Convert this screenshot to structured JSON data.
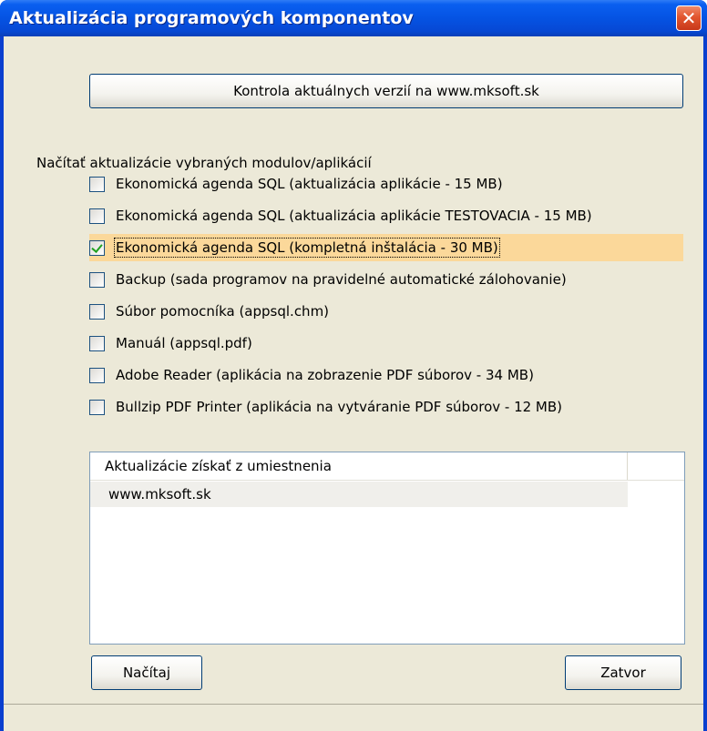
{
  "window": {
    "title": "Aktualizácia programových komponentov",
    "close_symbol": "✕"
  },
  "buttons": {
    "check_versions": "Kontrola aktuálnych verzií na www.mksoft.sk",
    "load": "Načítaj",
    "close": "Zatvor"
  },
  "modules": {
    "label": "Načítať aktualizácie vybraných modulov/aplikácií",
    "items": [
      {
        "label": "Ekonomická agenda SQL (aktualizácia aplikácie - 15 MB)",
        "checked": false
      },
      {
        "label": "Ekonomická agenda SQL (aktualizácia aplikácie TESTOVACIA - 15 MB)",
        "checked": false
      },
      {
        "label": "Ekonomická agenda SQL (kompletná inštalácia - 30 MB)",
        "checked": true
      },
      {
        "label": "Backup (sada programov na pravidelné automatické zálohovanie)",
        "checked": false
      },
      {
        "label": "Súbor pomocníka (appsql.chm)",
        "checked": false
      },
      {
        "label": "Manuál (appsql.pdf)",
        "checked": false
      },
      {
        "label": "Adobe Reader (aplikácia na zobrazenie PDF súborov - 34 MB)",
        "checked": false
      },
      {
        "label": "Bullzip PDF Printer (aplikácia na vytváranie PDF súborov - 12 MB)",
        "checked": false
      }
    ]
  },
  "sources": {
    "column_header": "Aktualizácie získať z umiestnenia",
    "rows": [
      "www.mksoft.sk"
    ]
  },
  "colors": {
    "title_bar": "#0553e3",
    "selection_highlight": "#fbd89a",
    "dialog_face": "#ece9d8",
    "close_button": "#e2562f"
  }
}
